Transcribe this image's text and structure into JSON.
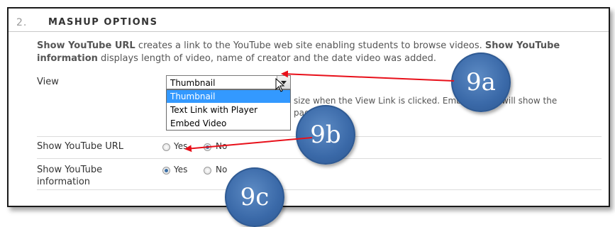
{
  "section": {
    "number": "2.",
    "title": "MASHUP OPTIONS",
    "description_parts": {
      "b1": "Show YouTube URL",
      "t1": " creates a link to the YouTube web site enabling students to browse videos. ",
      "b2": "Show YouTube information",
      "t2": " displays length of video, name of creator and the date video was added."
    }
  },
  "view": {
    "label": "View",
    "selected": "Thumbnail",
    "options": [
      "Thumbnail",
      "Text Link with Player",
      "Embed Video"
    ],
    "hint_line1": "size when the View Link is clicked. Embed Video will show the",
    "hint_line2": "page."
  },
  "show_url": {
    "label": "Show YouTube URL",
    "yes_label": "Yes",
    "no_label": "No",
    "selected": "No"
  },
  "show_info": {
    "label_line1": "Show YouTube",
    "label_line2": "information",
    "yes_label": "Yes",
    "no_label": "No",
    "selected": "Yes"
  },
  "callouts": {
    "a": "9a",
    "b": "9b",
    "c": "9c"
  },
  "colors": {
    "arrow": "#e8101a",
    "badge": "#3a69a8",
    "selection": "#3399ff"
  }
}
